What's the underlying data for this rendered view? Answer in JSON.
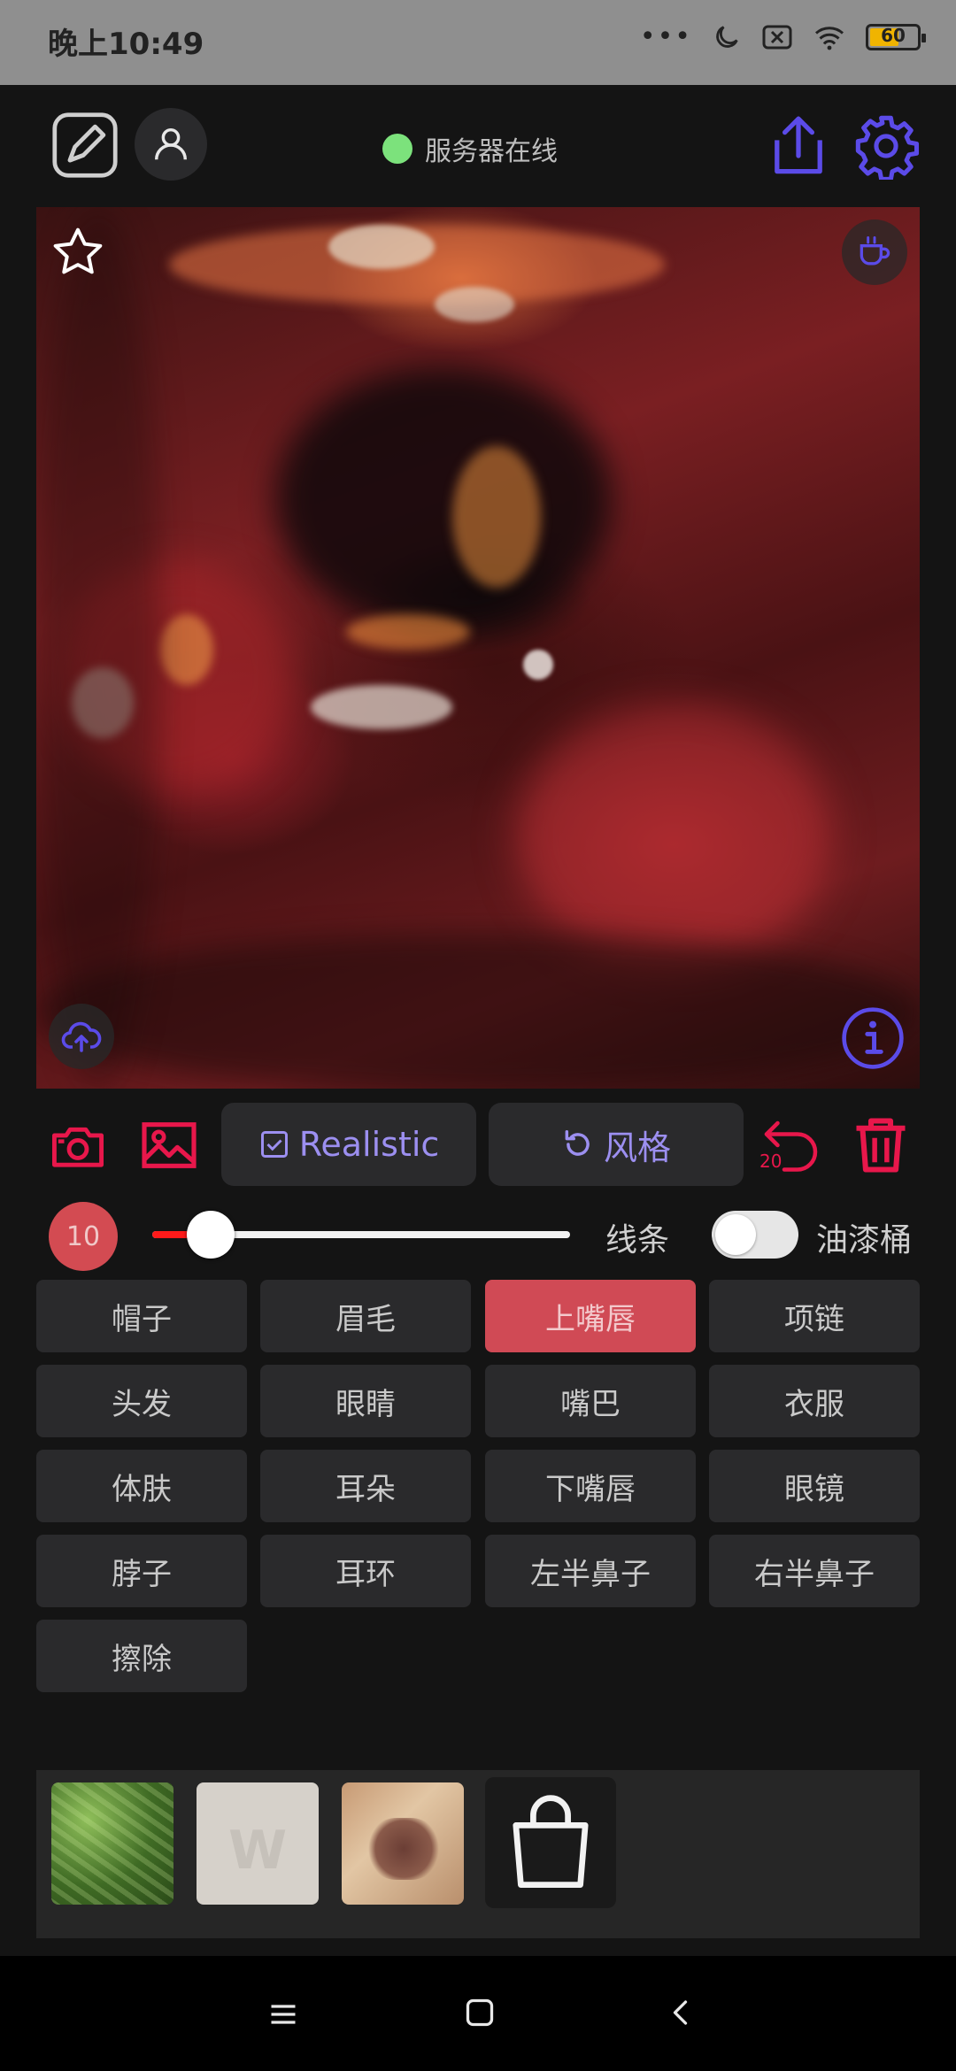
{
  "status_bar": {
    "time": "晚上10:49",
    "battery_level": "60"
  },
  "header": {
    "server_status": "服务器在线"
  },
  "toolbar": {
    "realistic_label": "Realistic",
    "style_label": "风格",
    "undo_count": "20"
  },
  "brush": {
    "size": "10",
    "line_label": "线条",
    "bucket_label": "油漆桶",
    "slider_value_fraction": 0.14,
    "bucket_enabled": false
  },
  "parts": [
    {
      "label": "帽子",
      "active": false
    },
    {
      "label": "眉毛",
      "active": false
    },
    {
      "label": "上嘴唇",
      "active": true
    },
    {
      "label": "项链",
      "active": false
    },
    {
      "label": "头发",
      "active": false
    },
    {
      "label": "眼睛",
      "active": false
    },
    {
      "label": "嘴巴",
      "active": false
    },
    {
      "label": "衣服",
      "active": false
    },
    {
      "label": "体肤",
      "active": false
    },
    {
      "label": "耳朵",
      "active": false
    },
    {
      "label": "下嘴唇",
      "active": false
    },
    {
      "label": "眼镜",
      "active": false
    },
    {
      "label": "脖子",
      "active": false
    },
    {
      "label": "耳环",
      "active": false
    },
    {
      "label": "左半鼻子",
      "active": false
    },
    {
      "label": "右半鼻子",
      "active": false
    },
    {
      "label": "擦除",
      "active": false
    }
  ],
  "colors": {
    "accent_red": "#e8174b",
    "accent_purple": "#9c8ff0",
    "icon_blue": "#5b4be8",
    "active_part": "#d04a55",
    "online_dot": "#7ce27c"
  },
  "icons": {
    "edit": "edit-square-icon",
    "user": "user-icon",
    "share": "share-icon",
    "settings": "gear-icon",
    "favorite": "star-icon",
    "coffee": "coffee-cup-icon",
    "upload": "cloud-upload-icon",
    "info": "info-icon",
    "camera": "camera-icon",
    "gallery": "image-icon",
    "undo": "undo-icon",
    "delete": "trash-icon",
    "shop": "shopping-bag-icon"
  }
}
